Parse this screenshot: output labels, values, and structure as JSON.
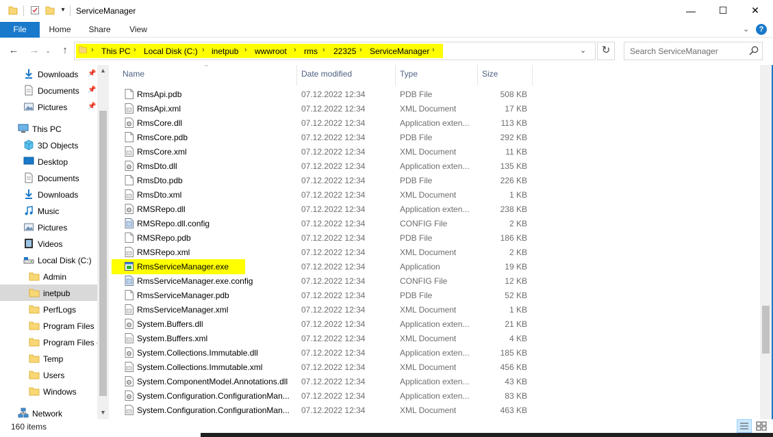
{
  "window": {
    "title": "ServiceManager",
    "controls": {
      "minimize": "—",
      "maximize": "☐",
      "close": "✕"
    }
  },
  "ribbon": {
    "tabs": [
      "File",
      "Home",
      "Share",
      "View"
    ],
    "help": "?"
  },
  "address": {
    "crumbs": [
      "This PC",
      "Local Disk (C:)",
      "inetpub",
      "wwwroot",
      "rms",
      "22325",
      "ServiceManager"
    ],
    "highlight_color": "#ffff00"
  },
  "search": {
    "placeholder": "Search ServiceManager"
  },
  "sidebar": {
    "items": [
      {
        "label": "Downloads",
        "icon": "download-arrow-icon",
        "pinned": true
      },
      {
        "label": "Documents",
        "icon": "document-icon",
        "pinned": true
      },
      {
        "label": "Pictures",
        "icon": "pictures-icon",
        "pinned": true
      },
      {
        "label": "This PC",
        "icon": "computer-icon"
      },
      {
        "label": "3D Objects",
        "icon": "cube-icon"
      },
      {
        "label": "Desktop",
        "icon": "desktop-icon"
      },
      {
        "label": "Documents",
        "icon": "document-icon"
      },
      {
        "label": "Downloads",
        "icon": "download-arrow-icon"
      },
      {
        "label": "Music",
        "icon": "music-note-icon"
      },
      {
        "label": "Pictures",
        "icon": "pictures-icon"
      },
      {
        "label": "Videos",
        "icon": "video-icon"
      },
      {
        "label": "Local Disk (C:)",
        "icon": "drive-icon"
      },
      {
        "label": "Admin",
        "icon": "folder-icon"
      },
      {
        "label": "inetpub",
        "icon": "folder-icon",
        "selected": true
      },
      {
        "label": "PerfLogs",
        "icon": "folder-icon"
      },
      {
        "label": "Program Files",
        "icon": "folder-icon"
      },
      {
        "label": "Program Files (",
        "icon": "folder-icon"
      },
      {
        "label": "Temp",
        "icon": "folder-icon"
      },
      {
        "label": "Users",
        "icon": "folder-icon"
      },
      {
        "label": "Windows",
        "icon": "folder-icon"
      },
      {
        "label": "Network",
        "icon": "network-icon"
      }
    ]
  },
  "columns": {
    "name": "Name",
    "date": "Date modified",
    "type": "Type",
    "size": "Size"
  },
  "files": [
    {
      "name": "RmsApi.pdb",
      "date": "07.12.2022 12:34",
      "type": "PDB File",
      "size": "508 KB",
      "kind": "pdb"
    },
    {
      "name": "RmsApi.xml",
      "date": "07.12.2022 12:34",
      "type": "XML Document",
      "size": "17 KB",
      "kind": "xml"
    },
    {
      "name": "RmsCore.dll",
      "date": "07.12.2022 12:34",
      "type": "Application exten...",
      "size": "113 KB",
      "kind": "dll"
    },
    {
      "name": "RmsCore.pdb",
      "date": "07.12.2022 12:34",
      "type": "PDB File",
      "size": "292 KB",
      "kind": "pdb"
    },
    {
      "name": "RmsCore.xml",
      "date": "07.12.2022 12:34",
      "type": "XML Document",
      "size": "11 KB",
      "kind": "xml"
    },
    {
      "name": "RmsDto.dll",
      "date": "07.12.2022 12:34",
      "type": "Application exten...",
      "size": "135 KB",
      "kind": "dll"
    },
    {
      "name": "RmsDto.pdb",
      "date": "07.12.2022 12:34",
      "type": "PDB File",
      "size": "226 KB",
      "kind": "pdb"
    },
    {
      "name": "RmsDto.xml",
      "date": "07.12.2022 12:34",
      "type": "XML Document",
      "size": "1 KB",
      "kind": "xml"
    },
    {
      "name": "RMSRepo.dll",
      "date": "07.12.2022 12:34",
      "type": "Application exten...",
      "size": "238 KB",
      "kind": "dll"
    },
    {
      "name": "RMSRepo.dll.config",
      "date": "07.12.2022 12:34",
      "type": "CONFIG File",
      "size": "2 KB",
      "kind": "config"
    },
    {
      "name": "RMSRepo.pdb",
      "date": "07.12.2022 12:34",
      "type": "PDB File",
      "size": "186 KB",
      "kind": "pdb"
    },
    {
      "name": "RMSRepo.xml",
      "date": "07.12.2022 12:34",
      "type": "XML Document",
      "size": "2 KB",
      "kind": "xml"
    },
    {
      "name": "RmsServiceManager.exe",
      "date": "07.12.2022 12:34",
      "type": "Application",
      "size": "19 KB",
      "kind": "exe",
      "highlighted": true
    },
    {
      "name": "RmsServiceManager.exe.config",
      "date": "07.12.2022 12:34",
      "type": "CONFIG File",
      "size": "12 KB",
      "kind": "config"
    },
    {
      "name": "RmsServiceManager.pdb",
      "date": "07.12.2022 12:34",
      "type": "PDB File",
      "size": "52 KB",
      "kind": "pdb"
    },
    {
      "name": "RmsServiceManager.xml",
      "date": "07.12.2022 12:34",
      "type": "XML Document",
      "size": "1 KB",
      "kind": "xml"
    },
    {
      "name": "System.Buffers.dll",
      "date": "07.12.2022 12:34",
      "type": "Application exten...",
      "size": "21 KB",
      "kind": "dll"
    },
    {
      "name": "System.Buffers.xml",
      "date": "07.12.2022 12:34",
      "type": "XML Document",
      "size": "4 KB",
      "kind": "xml"
    },
    {
      "name": "System.Collections.Immutable.dll",
      "date": "07.12.2022 12:34",
      "type": "Application exten...",
      "size": "185 KB",
      "kind": "dll"
    },
    {
      "name": "System.Collections.Immutable.xml",
      "date": "07.12.2022 12:34",
      "type": "XML Document",
      "size": "456 KB",
      "kind": "xml"
    },
    {
      "name": "System.ComponentModel.Annotations.dll",
      "date": "07.12.2022 12:34",
      "type": "Application exten...",
      "size": "43 KB",
      "kind": "dll"
    },
    {
      "name": "System.Configuration.ConfigurationMan...",
      "date": "07.12.2022 12:34",
      "type": "Application exten...",
      "size": "83 KB",
      "kind": "dll"
    },
    {
      "name": "System.Configuration.ConfigurationMan...",
      "date": "07.12.2022 12:34",
      "type": "XML Document",
      "size": "463 KB",
      "kind": "xml"
    }
  ],
  "status": {
    "count": "160 items"
  },
  "colors": {
    "accent": "#1979ca",
    "highlight": "#ffff00",
    "selection": "#d9d9d9"
  }
}
